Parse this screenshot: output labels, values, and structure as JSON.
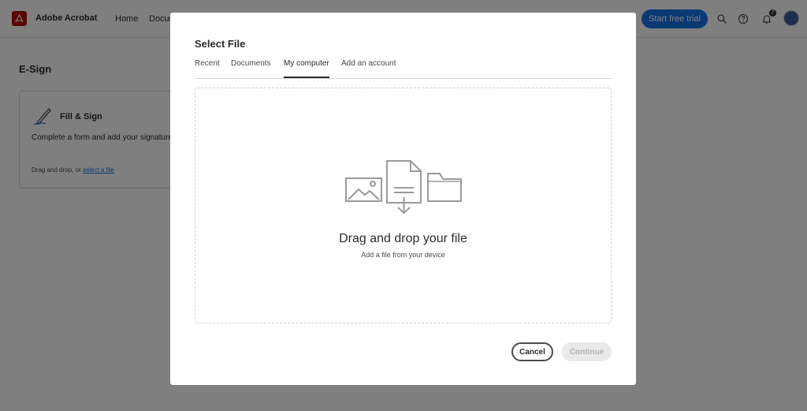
{
  "app": {
    "name": "Adobe Acrobat",
    "nav": [
      "Home",
      "Docum"
    ],
    "trial_button": "Start free trial",
    "notification_count": "2",
    "brand_color": "#1473e6",
    "logo_color": "#b30b00",
    "icons": [
      "acrobat-logo-icon",
      "search-icon",
      "help-icon",
      "bell-icon",
      "avatar"
    ]
  },
  "page": {
    "section_title": "E-Sign",
    "card": {
      "title": "Fill & Sign",
      "description": "Complete a form and add your signature",
      "footer_prefix": "Drag and drop, or ",
      "footer_link": "select a file",
      "icon": "pen-sign-icon"
    }
  },
  "modal": {
    "title": "Select File",
    "tabs": [
      "Recent",
      "Documents",
      "My computer",
      "Add an account"
    ],
    "active_tab": "My computer",
    "dropzone": {
      "title": "Drag and drop your file",
      "subtitle": "Add a file from your device",
      "icons": [
        "image-icon",
        "file-download-icon",
        "folder-icon"
      ]
    },
    "cancel_label": "Cancel",
    "continue_label": "Continue",
    "continue_disabled": true
  }
}
